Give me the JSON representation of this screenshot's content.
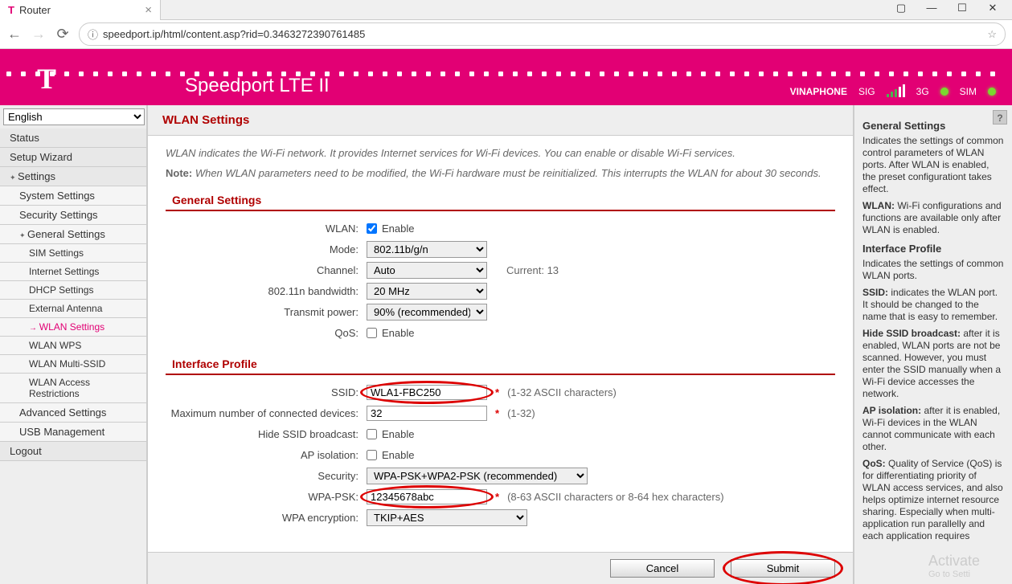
{
  "browser": {
    "tab_title": "Router",
    "url": "speedport.ip/html/content.asp?rid=0.3463272390761485"
  },
  "header": {
    "product": "Speedport LTE II",
    "carrier": "VINAPHONE",
    "sig_label": "SIG",
    "net3g": "3G",
    "sim": "SIM"
  },
  "sidebar": {
    "language": "English",
    "items": {
      "status": "Status",
      "wizard": "Setup Wizard",
      "settings": "Settings",
      "sys": "System Settings",
      "sec": "Security Settings",
      "gen": "General Settings",
      "sim": "SIM Settings",
      "internet": "Internet Settings",
      "dhcp": "DHCP Settings",
      "ext": "External Antenna",
      "wlan": "WLAN Settings",
      "wps": "WLAN WPS",
      "mssid": "WLAN Multi-SSID",
      "war": "WLAN Access Restrictions",
      "adv": "Advanced Settings",
      "usb": "USB Management",
      "logout": "Logout"
    }
  },
  "content": {
    "title": "WLAN Settings",
    "intro": "WLAN indicates the Wi-Fi network. It provides Internet services for Wi-Fi devices. You can enable or disable Wi-Fi services.",
    "note_label": "Note:",
    "note_text": " When WLAN parameters need to be modified, the Wi-Fi hardware must be reinitialized. This interrupts the WLAN for about 30 seconds.",
    "sec_general": "General Settings",
    "fields": {
      "wlan_label": "WLAN:",
      "enable": "Enable",
      "mode_label": "Mode:",
      "mode_val": "802.11b/g/n",
      "channel_label": "Channel:",
      "channel_val": "Auto",
      "channel_current": "Current: 13",
      "bw_label": "802.11n bandwidth:",
      "bw_val": "20 MHz",
      "tx_label": "Transmit power:",
      "tx_val": "90% (recommended)",
      "qos_label": "QoS:"
    },
    "sec_profile": "Interface Profile",
    "profile": {
      "ssid_label": "SSID:",
      "ssid_val": "WLA1-FBC250",
      "ssid_hint": "(1-32 ASCII characters)",
      "max_label": "Maximum number of connected devices:",
      "max_val": "32",
      "max_hint": "(1-32)",
      "hide_label": "Hide SSID broadcast:",
      "ap_label": "AP isolation:",
      "sec_label": "Security:",
      "sec_val": "WPA-PSK+WPA2-PSK (recommended)",
      "psk_label": "WPA-PSK:",
      "psk_val": "12345678abc",
      "psk_hint": "(8-63 ASCII characters or 8-64 hex characters)",
      "enc_label": "WPA encryption:",
      "enc_val": "TKIP+AES"
    },
    "buttons": {
      "cancel": "Cancel",
      "submit": "Submit"
    }
  },
  "help": {
    "h_general": "General Settings",
    "p_general": "Indicates the settings of common control parameters of WLAN ports. After WLAN is enabled, the preset configurationt takes effect.",
    "p_wlan": "Wi-Fi configurations and functions are available only after WLAN is enabled.",
    "h_interface": "Interface Profile",
    "p_interface": "Indicates the settings of common WLAN ports.",
    "p_ssid": "indicates the WLAN port. It should be changed to the name that is easy to remember.",
    "p_hide": "after it is enabled, WLAN ports are not be scanned. However, you must enter the SSID manually when a Wi-Fi device accesses the network.",
    "p_ap": "after it is enabled, Wi-Fi devices in the WLAN cannot communicate with each other.",
    "p_qos": "Quality of Service (QoS) is for differentiating priority of WLAN access services, and also helps optimize internet resource sharing. Especially when multi-application run parallelly and each application requires"
  },
  "watermark": {
    "title": "Activate",
    "sub": "Go to Setti"
  }
}
